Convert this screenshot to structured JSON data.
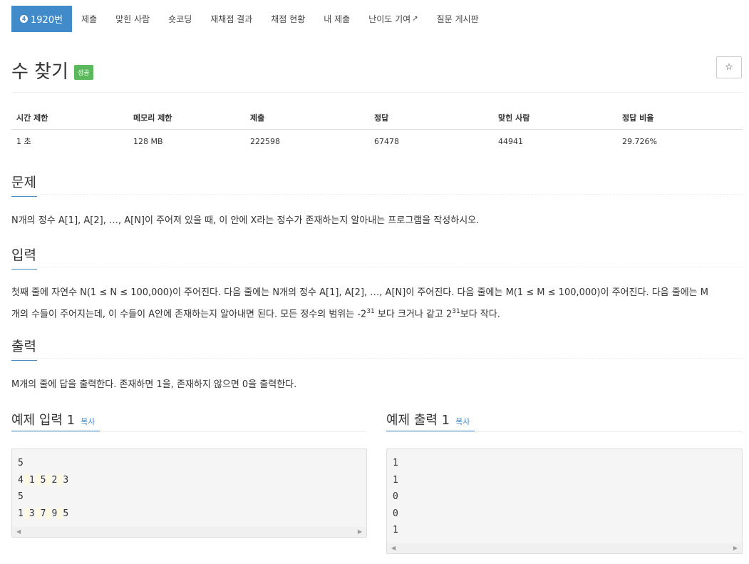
{
  "nav": {
    "problem_number": "1920번",
    "problem_icon": "4",
    "items": [
      "제출",
      "맞힌 사람",
      "숏코딩",
      "재채점 결과",
      "채점 현황",
      "내 제출",
      "난이도 기여",
      "질문 게시판"
    ],
    "external_icon": "external-link-icon"
  },
  "title": "수 찾기",
  "status_badge": "성공",
  "star_icon": "☆",
  "stats": {
    "headers": [
      "시간 제한",
      "메모리 제한",
      "제출",
      "정답",
      "맞힌 사람",
      "정답 비율"
    ],
    "values": [
      "1 초",
      "128 MB",
      "222598",
      "67478",
      "44941",
      "29.726%"
    ]
  },
  "sections": {
    "problem": {
      "heading": "문제",
      "text": "N개의 정수 A[1], A[2], …, A[N]이 주어져 있을 때, 이 안에 X라는 정수가 존재하는지 알아내는 프로그램을 작성하시오."
    },
    "input": {
      "heading": "입력",
      "text_line1": "첫째 줄에 자연수 N(1 ≤ N ≤ 100,000)이 주어진다. 다음 줄에는 N개의 정수 A[1], A[2], …, A[N]이 주어진다. 다음 줄에는 M(1 ≤ M ≤ 100,000)이 주어진다. 다음 줄에는 M",
      "text_line2_a": "개의 수들이 주어지는데, 이 수들이 A안에 존재하는지 알아내면 된다. 모든 정수의 범위는 -2",
      "sup1": "31",
      "text_line2_b": " 보다 크거나 같고 2",
      "sup2": "31",
      "text_line2_c": "보다 작다."
    },
    "output": {
      "heading": "출력",
      "text": "M개의 줄에 답을 출력한다. 존재하면 1을, 존재하지 않으면 0을 출력한다."
    }
  },
  "examples": {
    "input": {
      "heading": "예제 입력 1",
      "copy": "복사",
      "lines": [
        "5",
        "4 1 5 2 3",
        "5",
        "1 3 7 9 5"
      ]
    },
    "output": {
      "heading": "예제 출력 1",
      "copy": "복사",
      "lines": [
        "1",
        "1",
        "0",
        "0",
        "1"
      ]
    }
  }
}
